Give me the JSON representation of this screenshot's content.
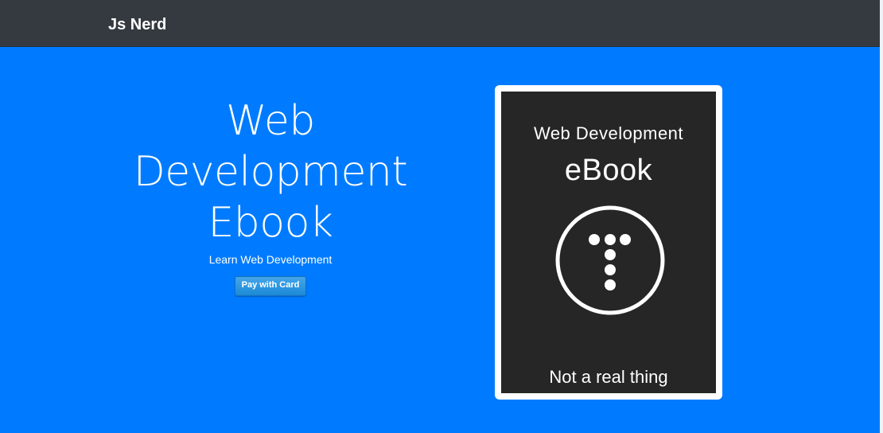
{
  "navbar": {
    "brand": "Js Nerd"
  },
  "hero": {
    "title_lines": [
      "Web",
      "Development",
      "Ebook"
    ],
    "subtitle": "Learn Web Development",
    "pay_button_label": "Pay with Card"
  },
  "ebook_cover": {
    "title": "Web Development",
    "subtitle": "eBook",
    "footer": "Not a real thing",
    "logo_icon": "t-dots-logo-icon"
  },
  "colors": {
    "hero_background": "#007bff",
    "navbar_background": "#343a40",
    "cover_background": "#262626",
    "pay_button": "#1a8ad6"
  }
}
